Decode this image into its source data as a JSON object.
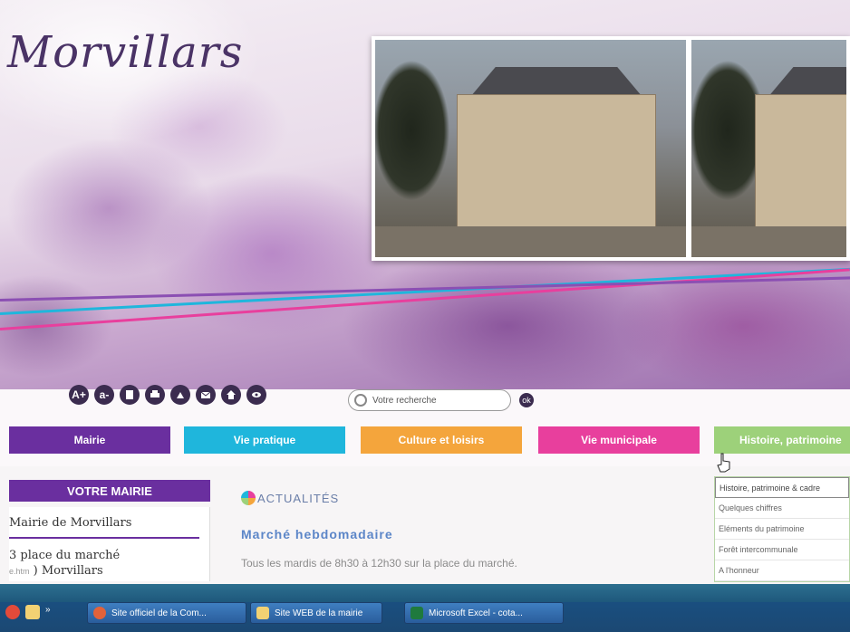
{
  "site": {
    "logo": "Morvillars"
  },
  "toolbar": {
    "icons": [
      "text-increase-icon",
      "text-decrease-icon",
      "document-icon",
      "print-icon",
      "accessibility-icon",
      "mail-icon",
      "home-icon",
      "view-icon"
    ],
    "labels": [
      "A+",
      "a-",
      "",
      "",
      "",
      "",
      "",
      ""
    ]
  },
  "search": {
    "placeholder": "Votre recherche",
    "go_label": "ok"
  },
  "nav": {
    "items": [
      {
        "label": "Mairie",
        "color": "#6a2f9f"
      },
      {
        "label": "Vie pratique",
        "color": "#1fb6dc"
      },
      {
        "label": "Culture et loisirs",
        "color": "#f4a53c"
      },
      {
        "label": "Vie municipale",
        "color": "#e83f9d"
      },
      {
        "label": "Histoire, patrimoine",
        "color": "#9dd17a"
      }
    ]
  },
  "dropdown": {
    "items": [
      "Histoire, patrimoine & cadre",
      "Quelques chiffres",
      "Eléments du patrimoine",
      "Forêt intercommunale",
      "A l'honneur"
    ]
  },
  "sidebar": {
    "title": "VOTRE MAIRIE",
    "name": "Mairie de Morvillars",
    "address_line1": "3 place du marché",
    "address_prefix": "e.htm",
    "address_line2": " ) Morvillars"
  },
  "news": {
    "section_title": "ACTUALITÉS",
    "headline": "Marché hebdomadaire",
    "body": "Tous les mardis de 8h30 à 12h30 sur la place du marché."
  },
  "taskbar": {
    "tasks": [
      {
        "label": "Site officiel de la Com...",
        "icon": "firefox-icon"
      },
      {
        "label": "Site WEB de la mairie",
        "icon": "folder-icon"
      },
      {
        "label": "Microsoft Excel - cota...",
        "icon": "excel-icon"
      }
    ]
  }
}
